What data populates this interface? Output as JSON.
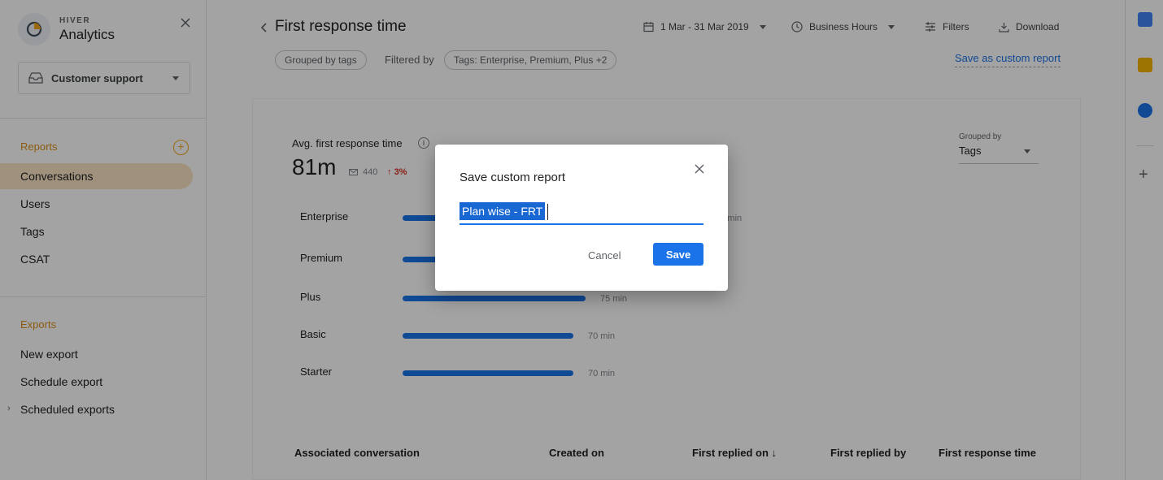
{
  "brand": {
    "small": "HIVER",
    "big": "Analytics"
  },
  "sidebar": {
    "inbox": "Customer support",
    "reports_title": "Reports",
    "report_items": [
      {
        "label": "Conversations",
        "active": true
      },
      {
        "label": "Users"
      },
      {
        "label": "Tags"
      },
      {
        "label": "CSAT"
      }
    ],
    "exports_title": "Exports",
    "export_items": [
      {
        "label": "New export"
      },
      {
        "label": "Schedule export"
      },
      {
        "label": "Scheduled exports"
      }
    ]
  },
  "header": {
    "title": "First response time",
    "date_range": "1 Mar - 31 Mar 2019",
    "hours": "Business Hours",
    "filters": "Filters",
    "download": "Download"
  },
  "filters_bar": {
    "grouped_chip": "Grouped by tags",
    "filtered_by": "Filtered by",
    "tags_chip": "Tags: Enterprise, Premium, Plus +2",
    "save_custom": "Save as custom report"
  },
  "metric": {
    "label": "Avg. first response time",
    "value": "81m",
    "count": "440",
    "change": "3%"
  },
  "grouping": {
    "label": "Grouped by",
    "value": "Tags"
  },
  "chart_data": {
    "type": "bar",
    "orientation": "horizontal",
    "categories": [
      "Enterprise",
      "Premium",
      "Plus",
      "Basic",
      "Starter"
    ],
    "values": [
      120,
      90,
      75,
      70,
      70
    ],
    "value_labels": [
      "120 min",
      "",
      "75 min",
      "70 min",
      "70 min"
    ],
    "unit": "min",
    "color": "#1a73e8"
  },
  "table": {
    "columns": [
      "Associated conversation",
      "Created on",
      "First replied on ↓",
      "First replied by",
      "First response time"
    ]
  },
  "dialog": {
    "title": "Save custom report",
    "input_value": "Plan wise - FRT",
    "cancel": "Cancel",
    "save": "Save"
  }
}
